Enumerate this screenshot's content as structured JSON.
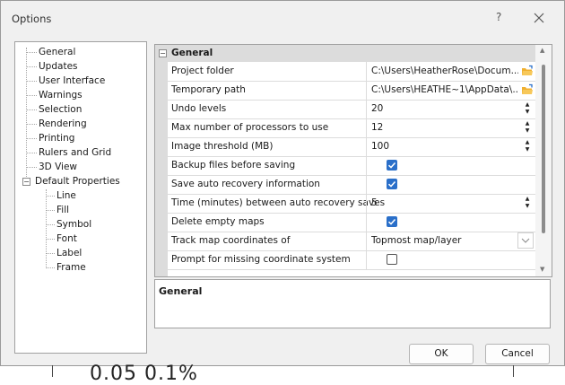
{
  "window": {
    "title": "Options",
    "help_glyph": "?",
    "close_glyph": "✕"
  },
  "tree": {
    "items": [
      {
        "label": "General"
      },
      {
        "label": "Updates"
      },
      {
        "label": "User Interface"
      },
      {
        "label": "Warnings"
      },
      {
        "label": "Selection"
      },
      {
        "label": "Rendering"
      },
      {
        "label": "Printing"
      },
      {
        "label": "Rulers and Grid"
      },
      {
        "label": "3D View"
      },
      {
        "label": "Default Properties",
        "expanded": true
      },
      {
        "label": "Line"
      },
      {
        "label": "Fill"
      },
      {
        "label": "Symbol"
      },
      {
        "label": "Font"
      },
      {
        "label": "Label"
      },
      {
        "label": "Frame"
      }
    ]
  },
  "grid": {
    "category": "General",
    "collapse_glyph": "−",
    "rows": [
      {
        "name": "Project folder",
        "value": "C:\\Users\\HeatherRose\\Docum...",
        "editor": "folder"
      },
      {
        "name": "Temporary path",
        "value": "C:\\Users\\HEATHE~1\\AppData\\...",
        "editor": "folder"
      },
      {
        "name": "Undo levels",
        "value": "20",
        "editor": "spinner"
      },
      {
        "name": "Max number of processors to use",
        "value": "12",
        "editor": "spinner"
      },
      {
        "name": "Image threshold (MB)",
        "value": "100",
        "editor": "spinner"
      },
      {
        "name": "Backup files before saving",
        "checked": true,
        "editor": "checkbox"
      },
      {
        "name": "Save auto recovery information",
        "checked": true,
        "editor": "checkbox"
      },
      {
        "name": "Time (minutes) between auto recovery saves",
        "value": "5",
        "editor": "spinner"
      },
      {
        "name": "Delete empty maps",
        "checked": true,
        "editor": "checkbox"
      },
      {
        "name": "Track map coordinates of",
        "value": "Topmost map/layer",
        "editor": "dropdown"
      },
      {
        "name": "Prompt for missing coordinate system",
        "checked": false,
        "editor": "checkbox"
      }
    ]
  },
  "description": {
    "title": "General"
  },
  "buttons": {
    "ok": "OK",
    "cancel": "Cancel"
  },
  "background_text": "0.05   0.1%",
  "colors": {
    "checkbox_on": "#2a6fc9",
    "folder_icon": "#f0b030",
    "header_bg": "#dcdcdc"
  }
}
